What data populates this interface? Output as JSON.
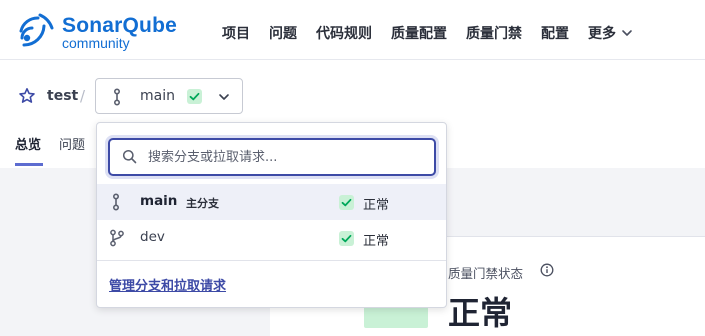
{
  "logo": {
    "line1": "SonarQube",
    "line2": "community"
  },
  "nav": {
    "items": [
      "项目",
      "问题",
      "代码规则",
      "质量配置",
      "质量门禁",
      "配置"
    ],
    "more_label": "更多"
  },
  "breadcrumb": {
    "project": "test",
    "separator": "/",
    "branch": "main"
  },
  "tabs": {
    "overview": "总览",
    "issues": "问题"
  },
  "dropdown": {
    "search_placeholder": "搜索分支或拉取请求...",
    "branches": [
      {
        "name": "main",
        "tag": "主分支",
        "status": "正常"
      },
      {
        "name": "dev",
        "status": "正常"
      }
    ],
    "manage_link": "管理分支和拉取请求"
  },
  "quality_gate": {
    "label": "质量门禁状态",
    "status": "正常"
  },
  "colors": {
    "brand": "#126ed3",
    "accent": "#3d4aa6",
    "ok_badge": "#c9f1d6",
    "ok_check": "#00a85a"
  }
}
